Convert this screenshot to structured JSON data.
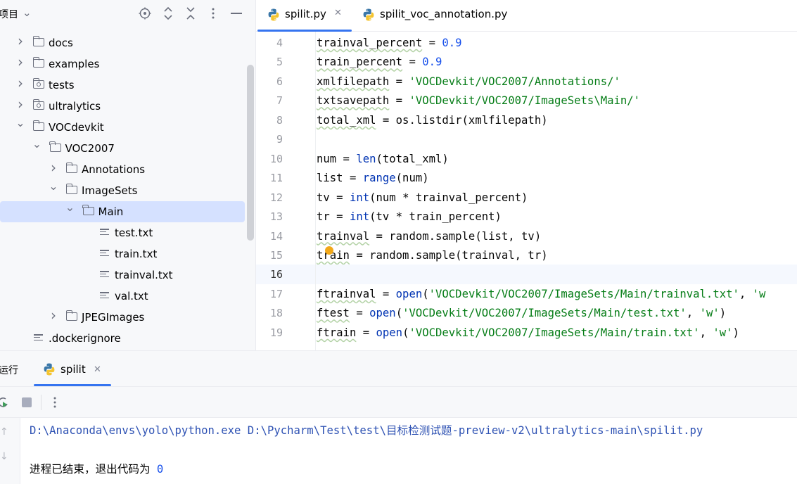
{
  "project": {
    "title": "项目",
    "tree": [
      {
        "label": "docs",
        "type": "folder",
        "depth": 0,
        "expanded": false
      },
      {
        "label": "examples",
        "type": "folder",
        "depth": 0,
        "expanded": false
      },
      {
        "label": "tests",
        "type": "package",
        "depth": 0,
        "expanded": false
      },
      {
        "label": "ultralytics",
        "type": "package",
        "depth": 0,
        "expanded": false
      },
      {
        "label": "VOCdevkit",
        "type": "folder",
        "depth": 0,
        "expanded": true
      },
      {
        "label": "VOC2007",
        "type": "folder",
        "depth": 1,
        "expanded": true
      },
      {
        "label": "Annotations",
        "type": "folder",
        "depth": 2,
        "expanded": false
      },
      {
        "label": "ImageSets",
        "type": "folder",
        "depth": 2,
        "expanded": true
      },
      {
        "label": "Main",
        "type": "folder",
        "depth": 3,
        "expanded": true,
        "selected": true
      },
      {
        "label": "test.txt",
        "type": "file",
        "depth": 4
      },
      {
        "label": "train.txt",
        "type": "file",
        "depth": 4
      },
      {
        "label": "trainval.txt",
        "type": "file",
        "depth": 4
      },
      {
        "label": "val.txt",
        "type": "file",
        "depth": 4
      },
      {
        "label": "JPEGImages",
        "type": "folder",
        "depth": 2,
        "expanded": false
      },
      {
        "label": ".dockerignore",
        "type": "file",
        "depth": 0
      }
    ]
  },
  "editor": {
    "tabs": [
      {
        "label": "spilit.py",
        "active": true
      },
      {
        "label": "spilit_voc_annotation.py",
        "active": false
      }
    ],
    "current_line": "16",
    "lines": [
      {
        "num": "4",
        "text": "trainval_percent = 0.9"
      },
      {
        "num": "5",
        "text": "train_percent = 0.9"
      },
      {
        "num": "6",
        "text": "xmlfilepath = 'VOCDevkit/VOC2007/Annotations/'"
      },
      {
        "num": "7",
        "text": "txtsavepath = 'VOCDevkit/VOC2007/ImageSets\\Main/'"
      },
      {
        "num": "8",
        "text": "total_xml = os.listdir(xmlfilepath)"
      },
      {
        "num": "9",
        "text": ""
      },
      {
        "num": "10",
        "text": "num = len(total_xml)"
      },
      {
        "num": "11",
        "text": "list = range(num)"
      },
      {
        "num": "12",
        "text": "tv = int(num * trainval_percent)"
      },
      {
        "num": "13",
        "text": "tr = int(tv * train_percent)"
      },
      {
        "num": "14",
        "text": "trainval = random.sample(list, tv)"
      },
      {
        "num": "15",
        "text": "train = random.sample(trainval, tr)"
      },
      {
        "num": "16",
        "text": ""
      },
      {
        "num": "17",
        "text": "ftrainval = open('VOCDevkit/VOC2007/ImageSets/Main/trainval.txt', 'w"
      },
      {
        "num": "18",
        "text": "ftest = open('VOCDevkit/VOC2007/ImageSets/Main/test.txt', 'w')"
      },
      {
        "num": "19",
        "text": "ftrain = open('VOCDevkit/VOC2007/ImageSets/Main/train.txt', 'w')"
      }
    ]
  },
  "run": {
    "title": "运行",
    "tab_label": "spilit",
    "output": {
      "command": "D:\\Anaconda\\envs\\yolo\\python.exe D:\\Pycharm\\Test\\test\\目标检测试题-preview-v2\\ultralytics-main\\spilit.py",
      "finished_prefix": "进程已结束，退出代码为 ",
      "exit_code": "0"
    }
  },
  "colors": {
    "accent": "#3574f0",
    "selection": "#d5e1ff",
    "number": "#1750eb",
    "string": "#067d17",
    "builtin": "#0033b3"
  }
}
